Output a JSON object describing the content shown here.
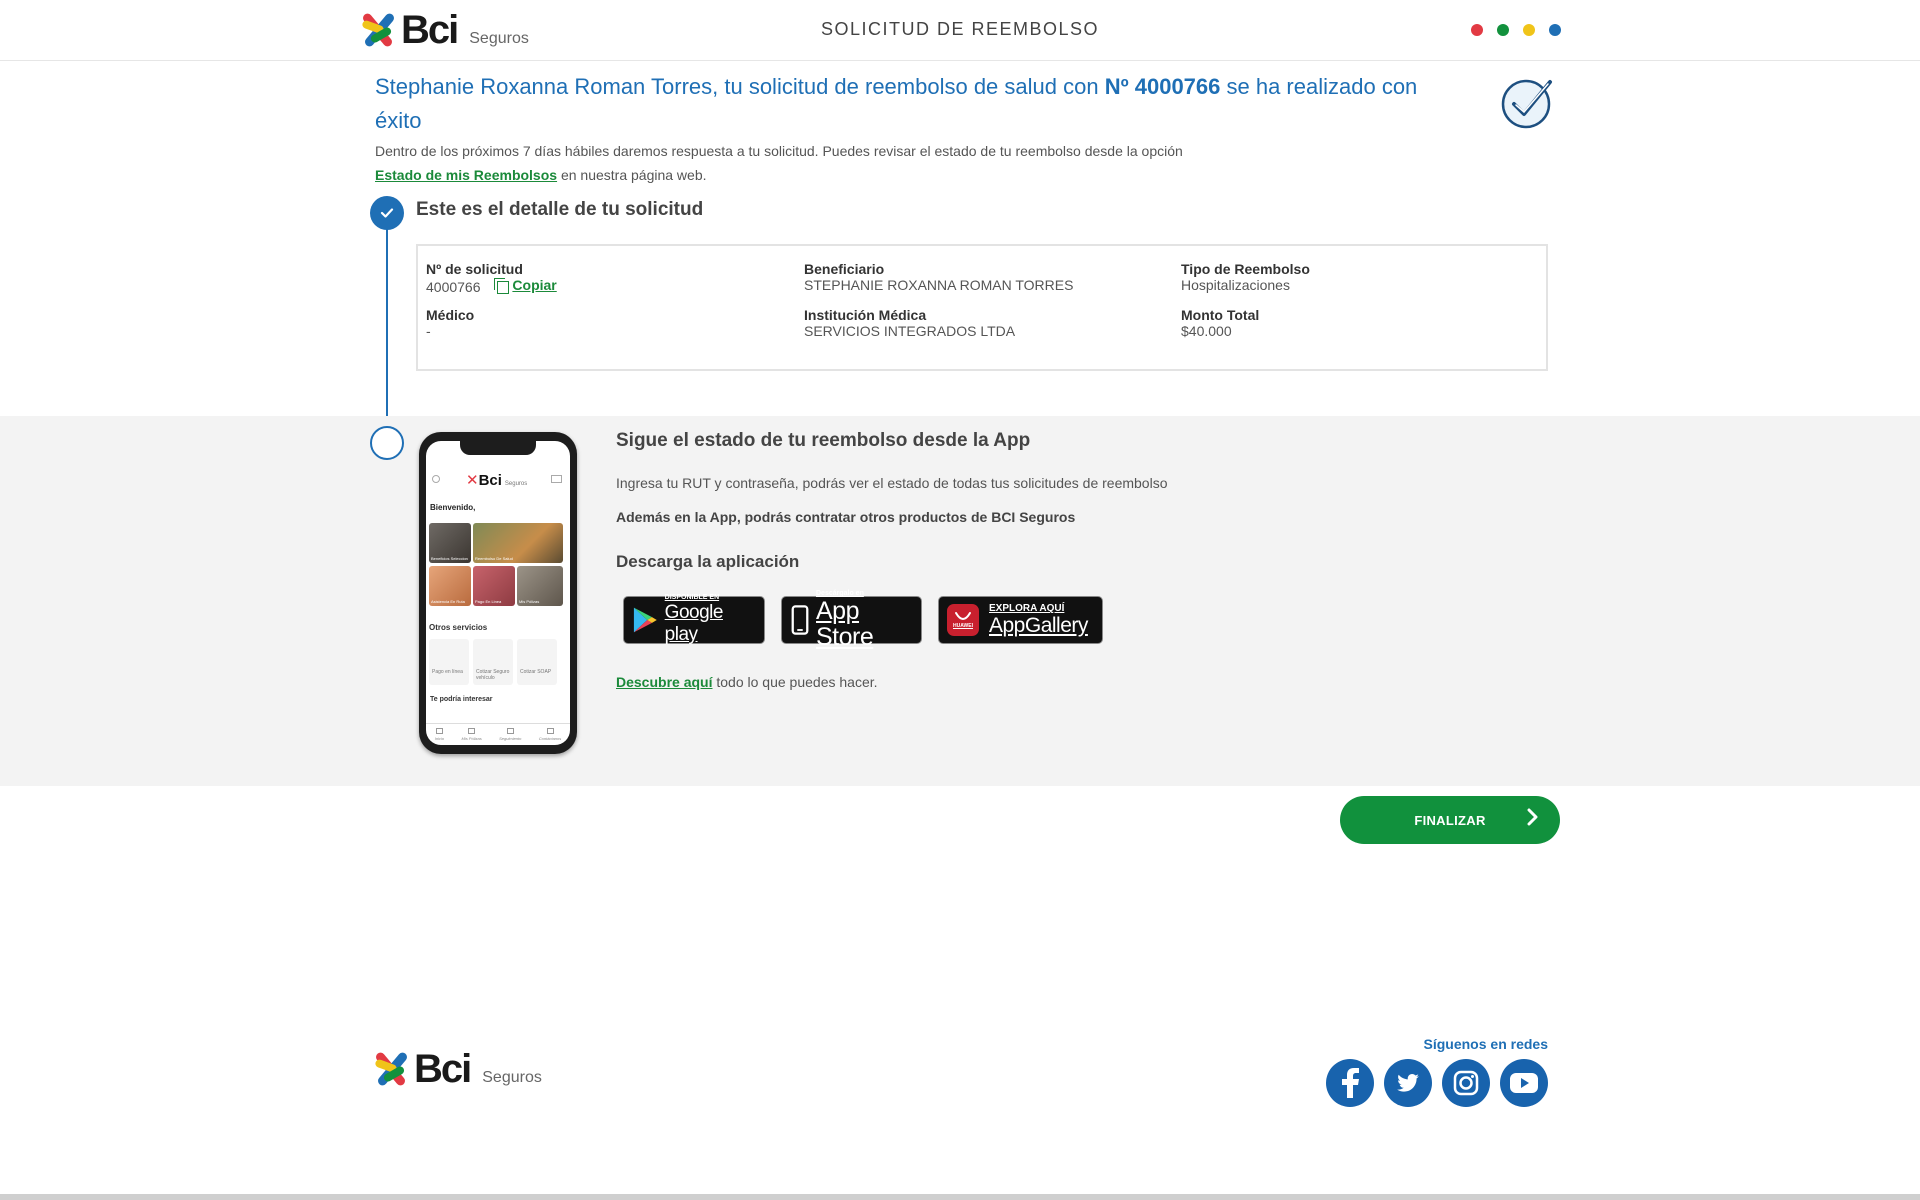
{
  "header": {
    "brand": "Bci",
    "brand_sub": "Seguros",
    "title": "SOLICITUD DE REEMBOLSO",
    "dot_colors": [
      "#e23a43",
      "#12913d",
      "#f0c419",
      "#1f6fb5"
    ]
  },
  "success": {
    "title_prefix": "Stephanie Roxanna Roman Torres, tu solicitud de reembolso de salud con ",
    "title_number": "Nº 4000766",
    "title_suffix": " se ha realizado con éxito",
    "message": "Dentro de los próximos 7 días hábiles daremos respuesta a tu solicitud. Puedes revisar el estado de tu reembolso desde la opción",
    "link_label": "Estado de mis Reembolsos",
    "message_suffix": " en nuestra página web."
  },
  "detail": {
    "title": "Este es el detalle de tu solicitud",
    "solicitud_label": "Nº de solicitud",
    "solicitud_value": "4000766",
    "copy_label": "Copiar",
    "beneficiario_label": "Beneficiario",
    "beneficiario_value": "STEPHANIE ROXANNA ROMAN TORRES",
    "tipo_label": "Tipo de Reembolso",
    "tipo_value": "Hospitalizaciones",
    "medico_label": "Médico",
    "medico_value": "-",
    "institucion_label": "Institución Médica",
    "institucion_value": "SERVICIOS INTEGRADOS LTDA",
    "monto_label": "Monto Total",
    "monto_value": "$40.000"
  },
  "phone": {
    "brand": "Bci",
    "brand_sub": "Seguros",
    "welcome": "Bienvenido,",
    "tiles": [
      "Beneficios Seleccion",
      "Reembolso De Salud",
      "Asistencia En Ruta",
      "Pago En Linea",
      "Mis Pólizas"
    ],
    "otros": "Otros servicios",
    "services": [
      "Pago en línea",
      "Cotizar Seguro vehículo",
      "Cotizar SOAP"
    ],
    "interes": "Te podría interesar",
    "nav": [
      "Inicio",
      "Mis Pólizas",
      "Seguimiento",
      "Contáctanos"
    ]
  },
  "app": {
    "title": "Sigue el estado de tu reembolso desde la App",
    "text1": "Ingresa tu RUT y contraseña, podrás ver el estado de todas tus solicitudes de reembolso",
    "text2": "Además en la App, podrás contratar otros productos de BCI Seguros",
    "download_title": "Descarga la aplicación",
    "google_small": "DISPONIBLE EN",
    "google_big": "Google play",
    "apple_small": "Descárgalo en",
    "apple_big": "App Store",
    "huawei_small": "EXPLORA AQUÍ",
    "huawei_big": "AppGallery",
    "huawei_brand": "HUAWEI",
    "discover_link": "Descubre aquí",
    "discover_suffix": " todo lo que puedes hacer."
  },
  "actions": {
    "finalizar": "FINALIZAR"
  },
  "footer": {
    "brand": "Bci",
    "brand_sub": "Seguros",
    "follow": "Síguenos en redes",
    "socials": [
      "facebook-icon",
      "twitter-icon",
      "instagram-icon",
      "youtube-icon"
    ]
  },
  "colors": {
    "primary_blue": "#1f6fb5",
    "green": "#11913d",
    "section_grey": "#f3f3f3"
  }
}
